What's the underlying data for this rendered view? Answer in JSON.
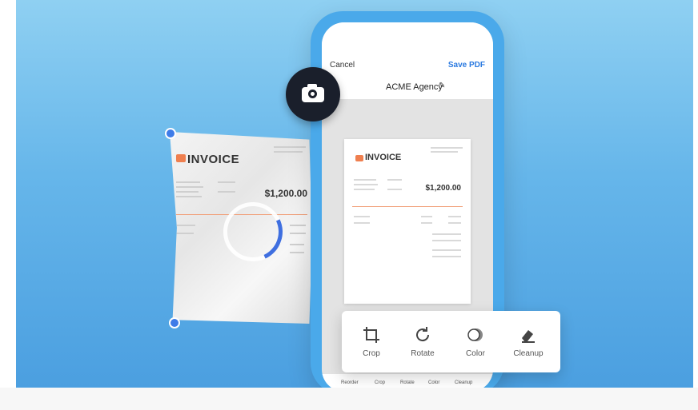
{
  "screen": {
    "cancel_label": "Cancel",
    "save_label": "Save PDF",
    "document_name": "ACME Agency"
  },
  "invoice": {
    "title": "INVOICE",
    "amount": "$1,200.00"
  },
  "tools": [
    {
      "label": "Crop",
      "icon": "crop-icon"
    },
    {
      "label": "Rotate",
      "icon": "rotate-icon"
    },
    {
      "label": "Color",
      "icon": "color-icon"
    },
    {
      "label": "Cleanup",
      "icon": "eraser-icon"
    }
  ],
  "bottom_bar": [
    "Reorder",
    "Crop",
    "Rotate",
    "Color",
    "Cleanup"
  ],
  "colors": {
    "accent": "#2b7ae0",
    "phone": "#4aa9ea",
    "invoice_accent": "#ef7f4f"
  }
}
